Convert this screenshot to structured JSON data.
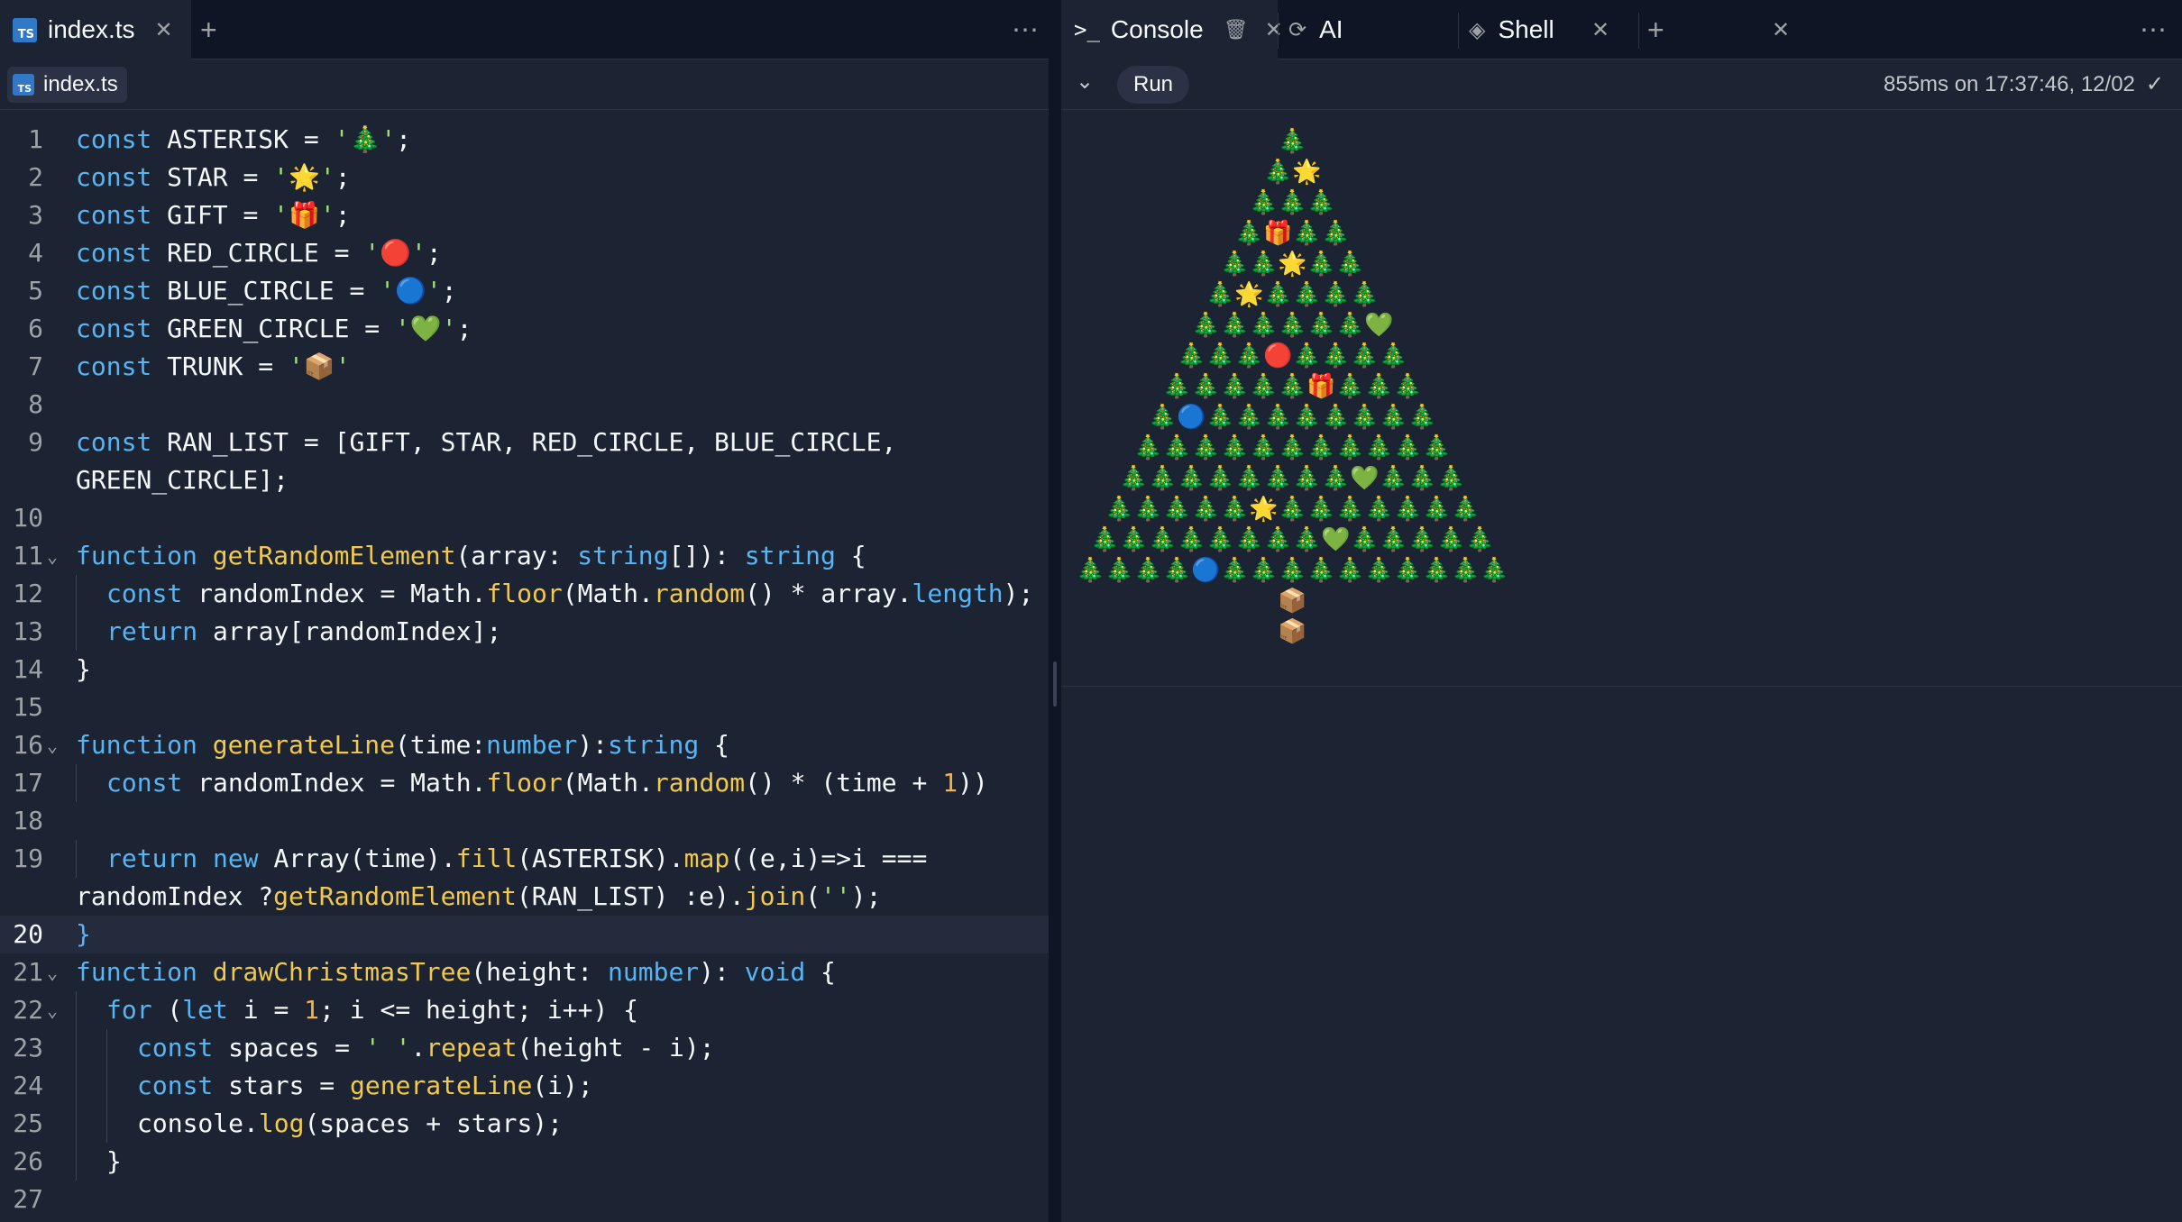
{
  "left": {
    "tab": {
      "badge": "TS",
      "label": "index.ts"
    },
    "breadcrumb": {
      "badge": "TS",
      "label": "index.ts"
    },
    "more": "⋯",
    "current_line": 20,
    "lines": [
      {
        "n": "1",
        "fold": false,
        "indent": 0,
        "tokens": [
          [
            "k",
            "const"
          ],
          [
            "p",
            " ASTERISK = "
          ],
          [
            "s",
            "'🎄'"
          ],
          [
            "p",
            ";"
          ]
        ]
      },
      {
        "n": "2",
        "fold": false,
        "indent": 0,
        "tokens": [
          [
            "k",
            "const"
          ],
          [
            "p",
            " STAR = "
          ],
          [
            "s",
            "'🌟'"
          ],
          [
            "p",
            ";"
          ]
        ]
      },
      {
        "n": "3",
        "fold": false,
        "indent": 0,
        "tokens": [
          [
            "k",
            "const"
          ],
          [
            "p",
            " GIFT = "
          ],
          [
            "s",
            "'🎁'"
          ],
          [
            "p",
            ";"
          ]
        ]
      },
      {
        "n": "4",
        "fold": false,
        "indent": 0,
        "tokens": [
          [
            "k",
            "const"
          ],
          [
            "p",
            " RED_CIRCLE = "
          ],
          [
            "s",
            "'🔴'"
          ],
          [
            "p",
            ";"
          ]
        ]
      },
      {
        "n": "5",
        "fold": false,
        "indent": 0,
        "tokens": [
          [
            "k",
            "const"
          ],
          [
            "p",
            " BLUE_CIRCLE = "
          ],
          [
            "s",
            "'🔵'"
          ],
          [
            "p",
            ";"
          ]
        ]
      },
      {
        "n": "6",
        "fold": false,
        "indent": 0,
        "tokens": [
          [
            "k",
            "const"
          ],
          [
            "p",
            " GREEN_CIRCLE = "
          ],
          [
            "s",
            "'💚'"
          ],
          [
            "p",
            ";"
          ]
        ]
      },
      {
        "n": "7",
        "fold": false,
        "indent": 0,
        "tokens": [
          [
            "k",
            "const"
          ],
          [
            "p",
            " TRUNK = "
          ],
          [
            "s",
            "'📦'"
          ]
        ]
      },
      {
        "n": "8",
        "fold": false,
        "indent": 0,
        "tokens": []
      },
      {
        "n": "9",
        "fold": false,
        "indent": 0,
        "tokens": [
          [
            "k",
            "const"
          ],
          [
            "p",
            " RAN_LIST = [GIFT, STAR, RED_CIRCLE, BLUE_CIRCLE,"
          ]
        ]
      },
      {
        "n": "",
        "fold": false,
        "indent": 0,
        "tokens": [
          [
            "p",
            "GREEN_CIRCLE];"
          ]
        ]
      },
      {
        "n": "10",
        "fold": false,
        "indent": 0,
        "tokens": []
      },
      {
        "n": "11",
        "fold": true,
        "indent": 0,
        "tokens": [
          [
            "k",
            "function"
          ],
          [
            "p",
            " "
          ],
          [
            "f",
            "getRandomElement"
          ],
          [
            "p",
            "(array: "
          ],
          [
            "t",
            "string"
          ],
          [
            "p",
            "[]): "
          ],
          [
            "t",
            "string"
          ],
          [
            "p",
            " {"
          ]
        ]
      },
      {
        "n": "12",
        "fold": false,
        "indent": 1,
        "tokens": [
          [
            "k",
            "const"
          ],
          [
            "p",
            " randomIndex = Math."
          ],
          [
            "f",
            "floor"
          ],
          [
            "p",
            "(Math."
          ],
          [
            "f",
            "random"
          ],
          [
            "p",
            "() * array."
          ],
          [
            "t",
            "length"
          ],
          [
            "p",
            ");"
          ]
        ]
      },
      {
        "n": "13",
        "fold": false,
        "indent": 1,
        "tokens": [
          [
            "k",
            "return"
          ],
          [
            "p",
            " array[randomIndex];"
          ]
        ]
      },
      {
        "n": "14",
        "fold": false,
        "indent": 0,
        "tokens": [
          [
            "p",
            "}"
          ]
        ]
      },
      {
        "n": "15",
        "fold": false,
        "indent": 0,
        "tokens": []
      },
      {
        "n": "16",
        "fold": true,
        "indent": 0,
        "tokens": [
          [
            "k",
            "function"
          ],
          [
            "p",
            " "
          ],
          [
            "f",
            "generateLine"
          ],
          [
            "p",
            "(time:"
          ],
          [
            "t",
            "number"
          ],
          [
            "p",
            "):"
          ],
          [
            "t",
            "string"
          ],
          [
            "p",
            " {"
          ]
        ]
      },
      {
        "n": "17",
        "fold": false,
        "indent": 1,
        "tokens": [
          [
            "k",
            "const"
          ],
          [
            "p",
            " randomIndex = Math."
          ],
          [
            "f",
            "floor"
          ],
          [
            "p",
            "(Math."
          ],
          [
            "f",
            "random"
          ],
          [
            "p",
            "() * (time + "
          ],
          [
            "n",
            "1"
          ],
          [
            "p",
            "))"
          ]
        ]
      },
      {
        "n": "18",
        "fold": false,
        "indent": 0,
        "tokens": []
      },
      {
        "n": "19",
        "fold": false,
        "indent": 1,
        "tokens": [
          [
            "k",
            "return"
          ],
          [
            "p",
            " "
          ],
          [
            "k",
            "new"
          ],
          [
            "p",
            " Array(time)."
          ],
          [
            "f",
            "fill"
          ],
          [
            "p",
            "(ASTERISK)."
          ],
          [
            "f",
            "map"
          ],
          [
            "p",
            "((e,i)=>i ==="
          ]
        ]
      },
      {
        "n": "",
        "fold": false,
        "indent": 0,
        "tokens": [
          [
            "p",
            "randomIndex ?"
          ],
          [
            "f",
            "getRandomElement"
          ],
          [
            "p",
            "(RAN_LIST) :e)."
          ],
          [
            "f",
            "join"
          ],
          [
            "p",
            "("
          ],
          [
            "s",
            "''"
          ],
          [
            "p",
            ");"
          ]
        ]
      },
      {
        "n": "20",
        "fold": false,
        "indent": 0,
        "tokens": [
          [
            "p",
            "}"
          ]
        ]
      },
      {
        "n": "21",
        "fold": true,
        "indent": 0,
        "tokens": [
          [
            "k",
            "function"
          ],
          [
            "p",
            " "
          ],
          [
            "f",
            "drawChristmasTree"
          ],
          [
            "p",
            "(height: "
          ],
          [
            "t",
            "number"
          ],
          [
            "p",
            "): "
          ],
          [
            "t",
            "void"
          ],
          [
            "p",
            " {"
          ]
        ]
      },
      {
        "n": "22",
        "fold": true,
        "indent": 1,
        "tokens": [
          [
            "k",
            "for"
          ],
          [
            "p",
            " ("
          ],
          [
            "k",
            "let"
          ],
          [
            "p",
            " i = "
          ],
          [
            "n",
            "1"
          ],
          [
            "p",
            "; i <= height; i++) {"
          ]
        ]
      },
      {
        "n": "23",
        "fold": false,
        "indent": 2,
        "tokens": [
          [
            "k",
            "const"
          ],
          [
            "p",
            " spaces = "
          ],
          [
            "s",
            "' '"
          ],
          [
            "p",
            "."
          ],
          [
            "f",
            "repeat"
          ],
          [
            "p",
            "(height - i);"
          ]
        ]
      },
      {
        "n": "24",
        "fold": false,
        "indent": 2,
        "tokens": [
          [
            "k",
            "const"
          ],
          [
            "p",
            " stars = "
          ],
          [
            "f",
            "generateLine"
          ],
          [
            "p",
            "(i);"
          ]
        ]
      },
      {
        "n": "25",
        "fold": false,
        "indent": 2,
        "tokens": [
          [
            "p",
            "console."
          ],
          [
            "f",
            "log"
          ],
          [
            "p",
            "(spaces + stars);"
          ]
        ]
      },
      {
        "n": "26",
        "fold": false,
        "indent": 1,
        "tokens": [
          [
            "p",
            "}"
          ]
        ]
      },
      {
        "n": "27",
        "fold": false,
        "indent": 0,
        "tokens": []
      }
    ]
  },
  "right": {
    "tabs": [
      {
        "icon": "terminal-icon",
        "glyph": ">_",
        "label": "Console",
        "extra": "trash-icon"
      },
      {
        "icon": "ai-icon",
        "glyph": "⟳",
        "label": "AI"
      },
      {
        "icon": "shell-icon",
        "glyph": "◈",
        "label": "Shell"
      }
    ],
    "more": "⋯",
    "run_label": "Run",
    "status": "855ms on 17:37:46, 12/02",
    "tree": [
      [
        "t"
      ],
      [
        "t",
        "star"
      ],
      [
        "t",
        "t",
        "t"
      ],
      [
        "t",
        "gift",
        "t",
        "t"
      ],
      [
        "t",
        "t",
        "star",
        "t",
        "t"
      ],
      [
        "t",
        "star",
        "t",
        "t",
        "t",
        "t"
      ],
      [
        "t",
        "t",
        "t",
        "t",
        "t",
        "t",
        "green"
      ],
      [
        "t",
        "t",
        "t",
        "red",
        "t",
        "t",
        "t",
        "t"
      ],
      [
        "t",
        "t",
        "t",
        "t",
        "t",
        "gift",
        "t",
        "t",
        "t"
      ],
      [
        "t",
        "blue",
        "t",
        "t",
        "t",
        "t",
        "t",
        "t",
        "t",
        "t"
      ],
      [
        "t",
        "t",
        "t",
        "t",
        "t",
        "t",
        "t",
        "t",
        "t",
        "t",
        "t"
      ],
      [
        "t",
        "t",
        "t",
        "t",
        "t",
        "t",
        "t",
        "t",
        "green",
        "t",
        "t",
        "t"
      ],
      [
        "t",
        "t",
        "t",
        "t",
        "t",
        "star",
        "t",
        "t",
        "t",
        "t",
        "t",
        "t",
        "t"
      ],
      [
        "t",
        "t",
        "t",
        "t",
        "t",
        "t",
        "t",
        "t",
        "green",
        "t",
        "t",
        "t",
        "t",
        "t"
      ],
      [
        "t",
        "t",
        "t",
        "t",
        "blue",
        "t",
        "t",
        "t",
        "t",
        "t",
        "t",
        "t",
        "t",
        "t",
        "t"
      ],
      [
        "trunk"
      ],
      [
        "trunk"
      ]
    ],
    "glyphs": {
      "t": "🎄",
      "star": "🌟",
      "gift": "🎁",
      "red": "🔴",
      "blue": "🔵",
      "green": "💚",
      "trunk": "📦"
    }
  }
}
